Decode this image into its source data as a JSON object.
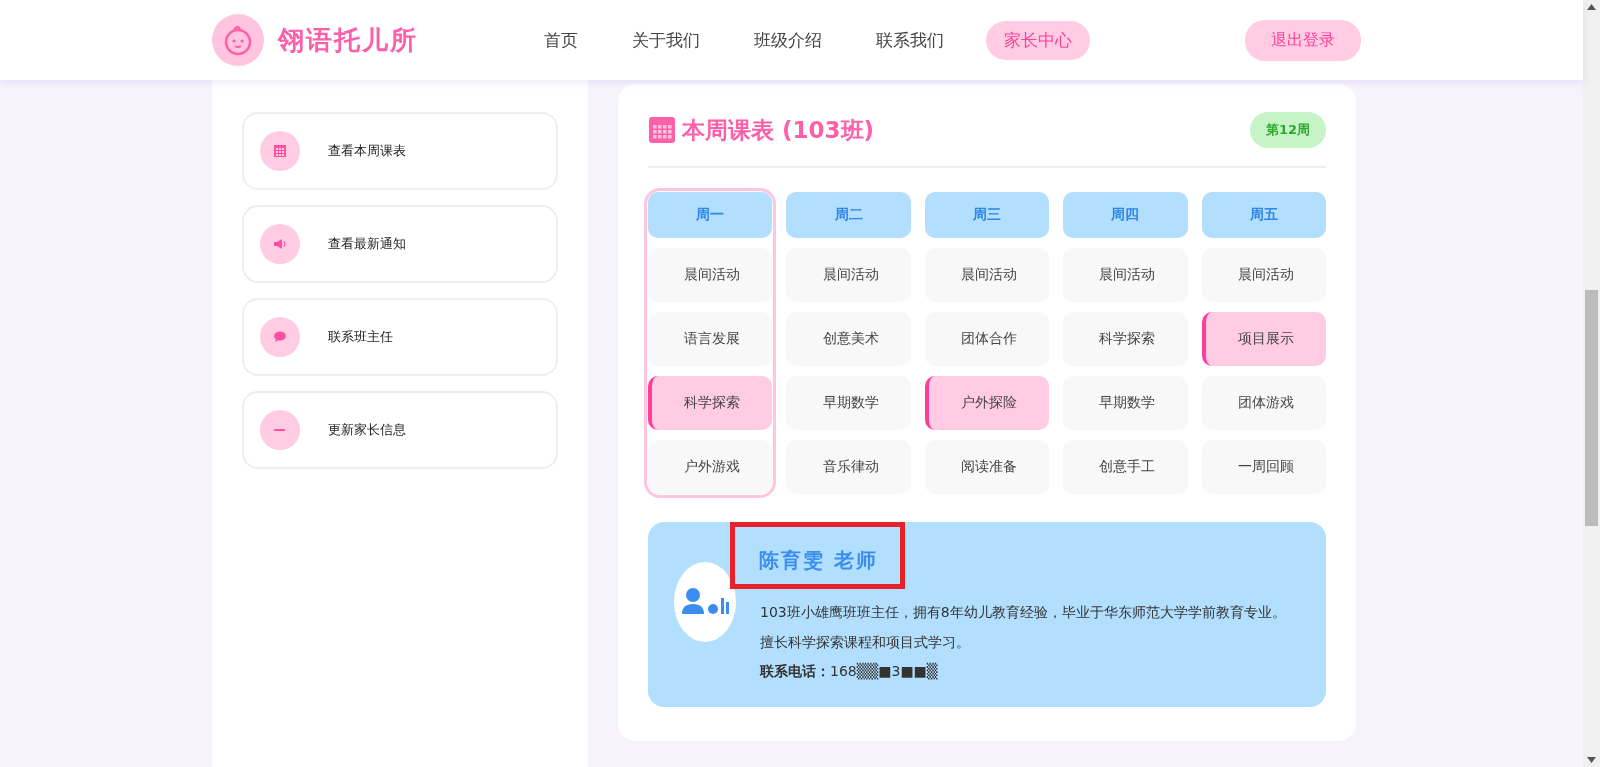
{
  "header": {
    "logo": "翎语托儿所",
    "nav": [
      {
        "label": "首页",
        "selected": false
      },
      {
        "label": "关于我们",
        "selected": false
      },
      {
        "label": "班级介绍",
        "selected": false
      },
      {
        "label": "联系我们",
        "selected": false
      },
      {
        "label": "家长中心",
        "selected": true
      }
    ],
    "logout": "退出登录"
  },
  "sidebar": {
    "items": [
      "查看本周课表",
      "查看最新通知",
      "联系班主任",
      "更新家长信息"
    ]
  },
  "schedule": {
    "title": "本周课表 (103班)",
    "week_badge": "第12周",
    "days": [
      {
        "label": "周一",
        "selected": true,
        "cells": [
          {
            "text": "晨间活动",
            "highlighted": false
          },
          {
            "text": "语言发展",
            "highlighted": false
          },
          {
            "text": "科学探索",
            "highlighted": true
          },
          {
            "text": "户外游戏",
            "highlighted": false
          }
        ]
      },
      {
        "label": "周二",
        "selected": false,
        "cells": [
          {
            "text": "晨间活动",
            "highlighted": false
          },
          {
            "text": "创意美术",
            "highlighted": false
          },
          {
            "text": "早期数学",
            "highlighted": false
          },
          {
            "text": "音乐律动",
            "highlighted": false
          }
        ]
      },
      {
        "label": "周三",
        "selected": false,
        "cells": [
          {
            "text": "晨间活动",
            "highlighted": false
          },
          {
            "text": "团体合作",
            "highlighted": false
          },
          {
            "text": "户外探险",
            "highlighted": true
          },
          {
            "text": "阅读准备",
            "highlighted": false
          }
        ]
      },
      {
        "label": "周四",
        "selected": false,
        "cells": [
          {
            "text": "晨间活动",
            "highlighted": false
          },
          {
            "text": "科学探索",
            "highlighted": false
          },
          {
            "text": "早期数学",
            "highlighted": false
          },
          {
            "text": "创意手工",
            "highlighted": false
          }
        ]
      },
      {
        "label": "周五",
        "selected": false,
        "cells": [
          {
            "text": "晨间活动",
            "highlighted": false
          },
          {
            "text": "项目展示",
            "highlighted": true
          },
          {
            "text": "团体游戏",
            "highlighted": false
          },
          {
            "text": "一周回顾",
            "highlighted": false
          }
        ]
      }
    ]
  },
  "teacher": {
    "name": "陈育雯 老师",
    "name_marked": true,
    "bio": "103班小雄鹰班班主任，拥有8年幼儿教育经验，毕业于华东师范大学学前教育专业。擅长科学探索课程和项目式学习。",
    "phone_label": "联系电话：",
    "phone": "168▒▒■3■■▒"
  }
}
